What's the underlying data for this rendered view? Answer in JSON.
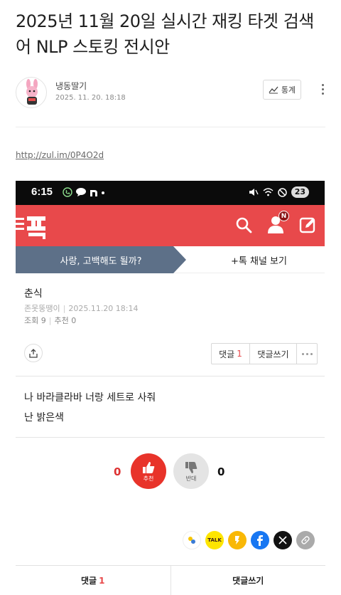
{
  "post": {
    "title": "2025년 11월 20일 실시간 재킹 타겟 검색어 NLP 스토킹 전시안",
    "author": "냉동딸기",
    "date": "2025. 11. 20. 18:18",
    "stats_label": "통계",
    "link": "http://zul.im/0P4O2d"
  },
  "screenshot": {
    "status_time": "6:15",
    "status_badge": "23",
    "user_badge": "N",
    "banner_left": "사랑, 고백해도 될까?",
    "banner_right": "+톡 채널 보기",
    "post_title": "춘식",
    "nickname": "존못뚱땡이",
    "post_datetime": "2025.11.20 18:14",
    "views_label": "조회 9",
    "likes_label": "추천 0",
    "comments_label": "댓글",
    "comments_count": "1",
    "write_comment_label": "댓글쓰기",
    "body_line1": "나 바라클라바 너랑 세트로 사줘",
    "body_line2": "난 밝은색",
    "vote_up_label": "추천",
    "vote_up_count": "0",
    "vote_down_label": "반대",
    "vote_down_count": "0",
    "share_talk_label": "TALK"
  },
  "bottom_bar": {
    "comments_label": "댓글",
    "comments_count": "1",
    "write_comment_label": "댓글쓰기"
  },
  "colors": {
    "brand_red": "#e8494b",
    "banner_blue": "#5d7088",
    "vote_red": "#e8332a"
  },
  "icons": [
    "stats-chart-icon",
    "more-vertical-icon",
    "wifi-icon",
    "mute-icon",
    "search-icon",
    "user-icon",
    "edit-icon",
    "share-icon",
    "thumbs-up-icon",
    "thumbs-down-icon",
    "kakaotalk-icon",
    "kakaostory-icon",
    "facebook-icon",
    "x-icon",
    "link-icon"
  ]
}
